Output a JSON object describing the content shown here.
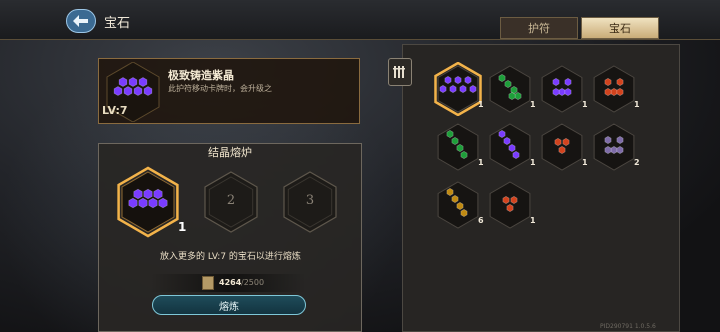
{
  "header": {
    "title": "宝石"
  },
  "tabs": [
    {
      "label": "护符",
      "active": false
    },
    {
      "label": "宝石",
      "active": true
    }
  ],
  "selected_gem": {
    "name": "极致铸造紫晶",
    "description": "此护符移动卡牌时，会升级之",
    "level": "LV:7",
    "color": "#7a3cff"
  },
  "furnace": {
    "title": "结晶熔炉",
    "slots": [
      {
        "filled": true,
        "count": "1",
        "color": "#7a3cff"
      },
      {
        "filled": false,
        "number": "2"
      },
      {
        "filled": false,
        "number": "3"
      }
    ],
    "hint": "放入更多的 LV:7 的宝石以进行熔炼",
    "cost_have": "4264",
    "cost_need": "/2500",
    "smelt_label": "熔炼"
  },
  "gems": [
    {
      "color": "#7a3cff",
      "count": "1",
      "selected": true,
      "pattern": "pyramid"
    },
    {
      "color": "#1e9e3a",
      "count": "1",
      "selected": false,
      "pattern": "diag"
    },
    {
      "color": "#7a3cff",
      "count": "1",
      "selected": false,
      "pattern": "tri"
    },
    {
      "color": "#d2431e",
      "count": "1",
      "selected": false,
      "pattern": "tri"
    },
    {
      "color": "#1e9e3a",
      "count": "1",
      "selected": false,
      "pattern": "line"
    },
    {
      "color": "#7a3cff",
      "count": "1",
      "selected": false,
      "pattern": "line"
    },
    {
      "color": "#d2431e",
      "count": "1",
      "selected": false,
      "pattern": "pair"
    },
    {
      "color": "#7e6ca8",
      "count": "2",
      "selected": false,
      "pattern": "tri"
    },
    {
      "color": "#c08a12",
      "count": "6",
      "selected": false,
      "pattern": "line"
    },
    {
      "color": "#d2431e",
      "count": "1",
      "selected": false,
      "pattern": "pair"
    }
  ],
  "footer": {
    "pid": "PID290791 1.0.5.6"
  }
}
